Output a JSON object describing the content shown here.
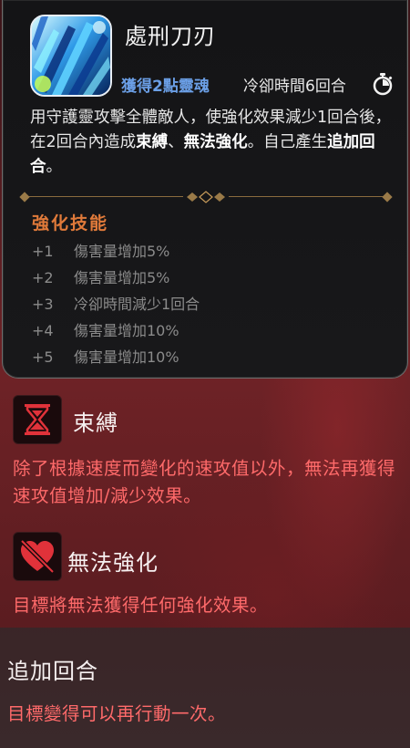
{
  "skill": {
    "name": "處刑刀刃",
    "soul_gain": "獲得2點靈魂",
    "cooldown": "冷卻時間6回合",
    "icon": "blue-blade-icon",
    "description": {
      "part1": "用守護靈攻擊全體敵人，使強化效果減少1回合後，在2回合內造成",
      "hl1": "束縛",
      "sep1": "、",
      "hl2": "無法強化",
      "part2": "。自己產生",
      "hl3": "追加回合",
      "part3": "。"
    }
  },
  "enhance": {
    "title": "強化技能",
    "items": [
      {
        "level": "+1",
        "text": "傷害量增加5%"
      },
      {
        "level": "+2",
        "text": "傷害量增加5%"
      },
      {
        "level": "+3",
        "text": "冷卻時間減少1回合"
      },
      {
        "level": "+4",
        "text": "傷害量增加10%"
      },
      {
        "level": "+5",
        "text": "傷害量增加10%"
      }
    ]
  },
  "effects": [
    {
      "name": "束縛",
      "icon": "hourglass-icon",
      "description": "除了根據速度而變化的速攻值以外，無法再獲得速攻值增加/減少效果。"
    },
    {
      "name": "無法強化",
      "icon": "broken-heart-icon",
      "description": "目標將無法獲得任何強化效果。"
    },
    {
      "name": "追加回合",
      "description": "目標變得可以再行動一次。"
    }
  ],
  "colors": {
    "soul_gain": "#6b9fe6",
    "enhance_title": "#e07a3a",
    "debuff_text": "#ff6a6a",
    "icon_red": "#e0323a"
  }
}
